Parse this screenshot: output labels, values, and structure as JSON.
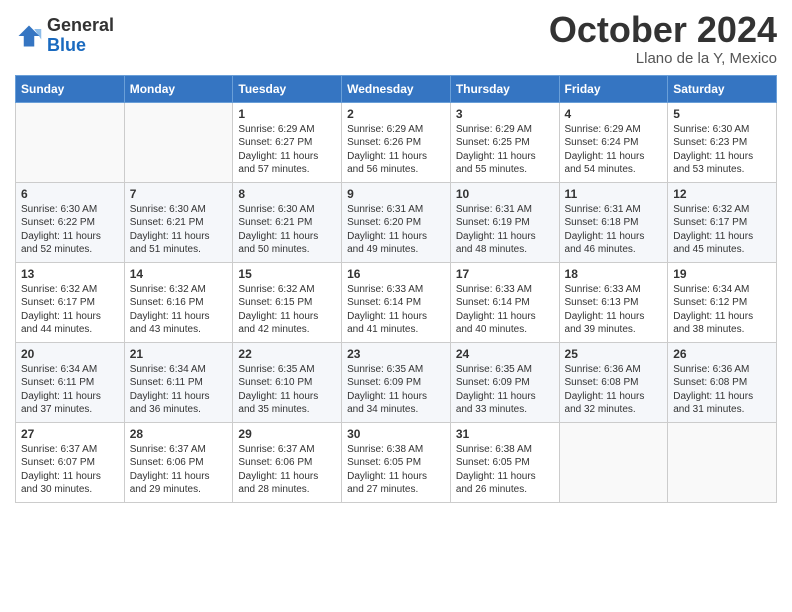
{
  "logo": {
    "general": "General",
    "blue": "Blue"
  },
  "header": {
    "month": "October 2024",
    "location": "Llano de la Y, Mexico"
  },
  "weekdays": [
    "Sunday",
    "Monday",
    "Tuesday",
    "Wednesday",
    "Thursday",
    "Friday",
    "Saturday"
  ],
  "weeks": [
    [
      {
        "day": "",
        "info": ""
      },
      {
        "day": "",
        "info": ""
      },
      {
        "day": "1",
        "info": "Sunrise: 6:29 AM\nSunset: 6:27 PM\nDaylight: 11 hours and 57 minutes."
      },
      {
        "day": "2",
        "info": "Sunrise: 6:29 AM\nSunset: 6:26 PM\nDaylight: 11 hours and 56 minutes."
      },
      {
        "day": "3",
        "info": "Sunrise: 6:29 AM\nSunset: 6:25 PM\nDaylight: 11 hours and 55 minutes."
      },
      {
        "day": "4",
        "info": "Sunrise: 6:29 AM\nSunset: 6:24 PM\nDaylight: 11 hours and 54 minutes."
      },
      {
        "day": "5",
        "info": "Sunrise: 6:30 AM\nSunset: 6:23 PM\nDaylight: 11 hours and 53 minutes."
      }
    ],
    [
      {
        "day": "6",
        "info": "Sunrise: 6:30 AM\nSunset: 6:22 PM\nDaylight: 11 hours and 52 minutes."
      },
      {
        "day": "7",
        "info": "Sunrise: 6:30 AM\nSunset: 6:21 PM\nDaylight: 11 hours and 51 minutes."
      },
      {
        "day": "8",
        "info": "Sunrise: 6:30 AM\nSunset: 6:21 PM\nDaylight: 11 hours and 50 minutes."
      },
      {
        "day": "9",
        "info": "Sunrise: 6:31 AM\nSunset: 6:20 PM\nDaylight: 11 hours and 49 minutes."
      },
      {
        "day": "10",
        "info": "Sunrise: 6:31 AM\nSunset: 6:19 PM\nDaylight: 11 hours and 48 minutes."
      },
      {
        "day": "11",
        "info": "Sunrise: 6:31 AM\nSunset: 6:18 PM\nDaylight: 11 hours and 46 minutes."
      },
      {
        "day": "12",
        "info": "Sunrise: 6:32 AM\nSunset: 6:17 PM\nDaylight: 11 hours and 45 minutes."
      }
    ],
    [
      {
        "day": "13",
        "info": "Sunrise: 6:32 AM\nSunset: 6:17 PM\nDaylight: 11 hours and 44 minutes."
      },
      {
        "day": "14",
        "info": "Sunrise: 6:32 AM\nSunset: 6:16 PM\nDaylight: 11 hours and 43 minutes."
      },
      {
        "day": "15",
        "info": "Sunrise: 6:32 AM\nSunset: 6:15 PM\nDaylight: 11 hours and 42 minutes."
      },
      {
        "day": "16",
        "info": "Sunrise: 6:33 AM\nSunset: 6:14 PM\nDaylight: 11 hours and 41 minutes."
      },
      {
        "day": "17",
        "info": "Sunrise: 6:33 AM\nSunset: 6:14 PM\nDaylight: 11 hours and 40 minutes."
      },
      {
        "day": "18",
        "info": "Sunrise: 6:33 AM\nSunset: 6:13 PM\nDaylight: 11 hours and 39 minutes."
      },
      {
        "day": "19",
        "info": "Sunrise: 6:34 AM\nSunset: 6:12 PM\nDaylight: 11 hours and 38 minutes."
      }
    ],
    [
      {
        "day": "20",
        "info": "Sunrise: 6:34 AM\nSunset: 6:11 PM\nDaylight: 11 hours and 37 minutes."
      },
      {
        "day": "21",
        "info": "Sunrise: 6:34 AM\nSunset: 6:11 PM\nDaylight: 11 hours and 36 minutes."
      },
      {
        "day": "22",
        "info": "Sunrise: 6:35 AM\nSunset: 6:10 PM\nDaylight: 11 hours and 35 minutes."
      },
      {
        "day": "23",
        "info": "Sunrise: 6:35 AM\nSunset: 6:09 PM\nDaylight: 11 hours and 34 minutes."
      },
      {
        "day": "24",
        "info": "Sunrise: 6:35 AM\nSunset: 6:09 PM\nDaylight: 11 hours and 33 minutes."
      },
      {
        "day": "25",
        "info": "Sunrise: 6:36 AM\nSunset: 6:08 PM\nDaylight: 11 hours and 32 minutes."
      },
      {
        "day": "26",
        "info": "Sunrise: 6:36 AM\nSunset: 6:08 PM\nDaylight: 11 hours and 31 minutes."
      }
    ],
    [
      {
        "day": "27",
        "info": "Sunrise: 6:37 AM\nSunset: 6:07 PM\nDaylight: 11 hours and 30 minutes."
      },
      {
        "day": "28",
        "info": "Sunrise: 6:37 AM\nSunset: 6:06 PM\nDaylight: 11 hours and 29 minutes."
      },
      {
        "day": "29",
        "info": "Sunrise: 6:37 AM\nSunset: 6:06 PM\nDaylight: 11 hours and 28 minutes."
      },
      {
        "day": "30",
        "info": "Sunrise: 6:38 AM\nSunset: 6:05 PM\nDaylight: 11 hours and 27 minutes."
      },
      {
        "day": "31",
        "info": "Sunrise: 6:38 AM\nSunset: 6:05 PM\nDaylight: 11 hours and 26 minutes."
      },
      {
        "day": "",
        "info": ""
      },
      {
        "day": "",
        "info": ""
      }
    ]
  ]
}
